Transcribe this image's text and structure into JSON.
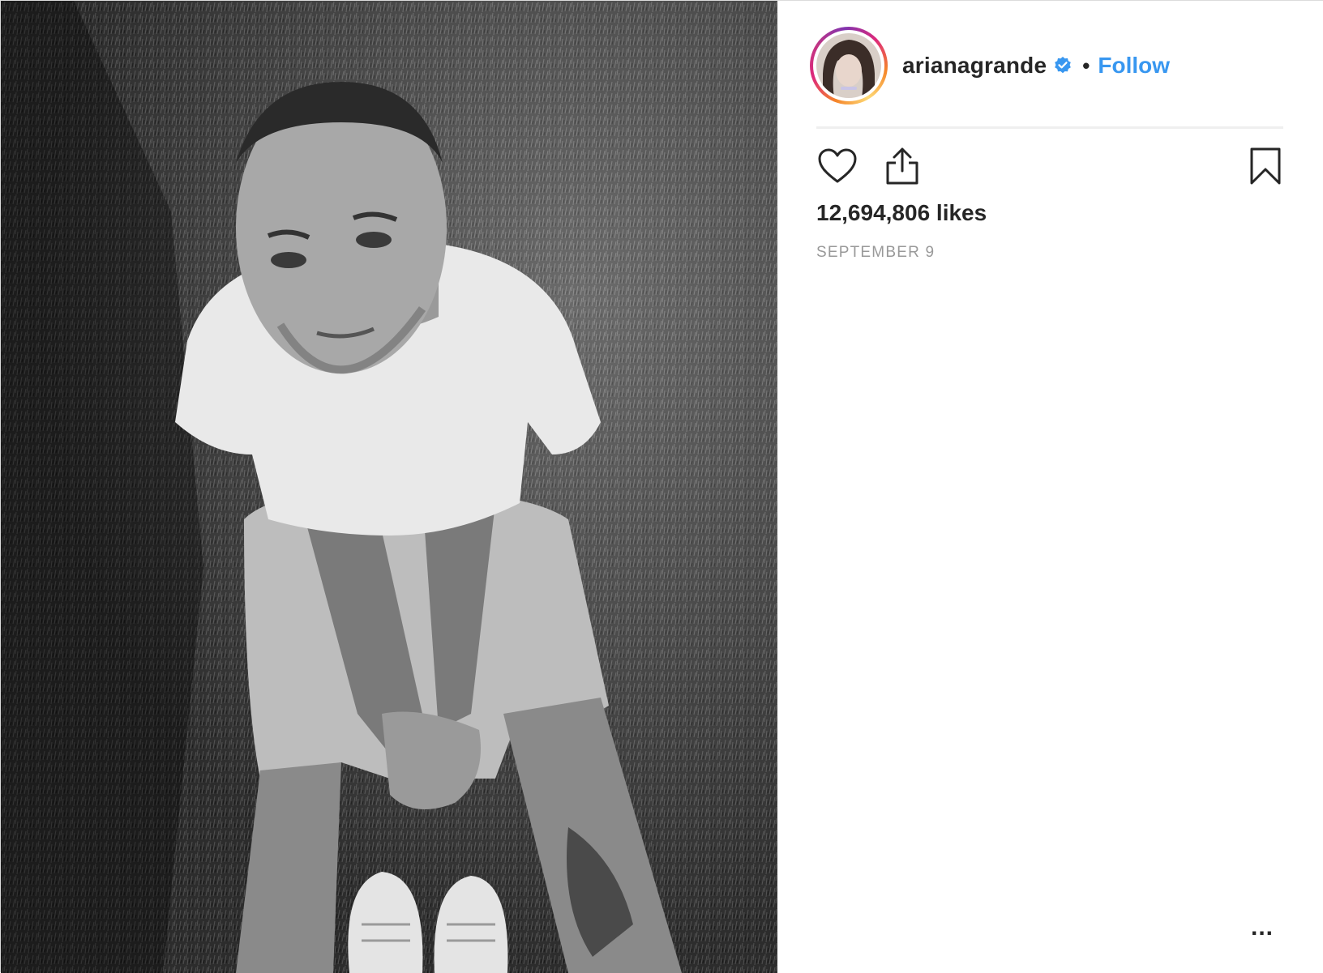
{
  "post": {
    "photo": {
      "alt_icon": "photo-image",
      "tone": "black-and-white"
    },
    "author": {
      "username": "arianagrande",
      "verified": true,
      "separator": "•",
      "follow_label": "Follow"
    },
    "actions": {
      "like_icon": "heart-icon",
      "share_icon": "share-icon",
      "save_icon": "bookmark-icon"
    },
    "likes_text": "12,694,806 likes",
    "date_text": "SEPTEMBER 9",
    "more_label": "..."
  },
  "colors": {
    "link": "#3897f0",
    "text": "#262626",
    "muted": "#999999",
    "divider": "#efefef"
  }
}
